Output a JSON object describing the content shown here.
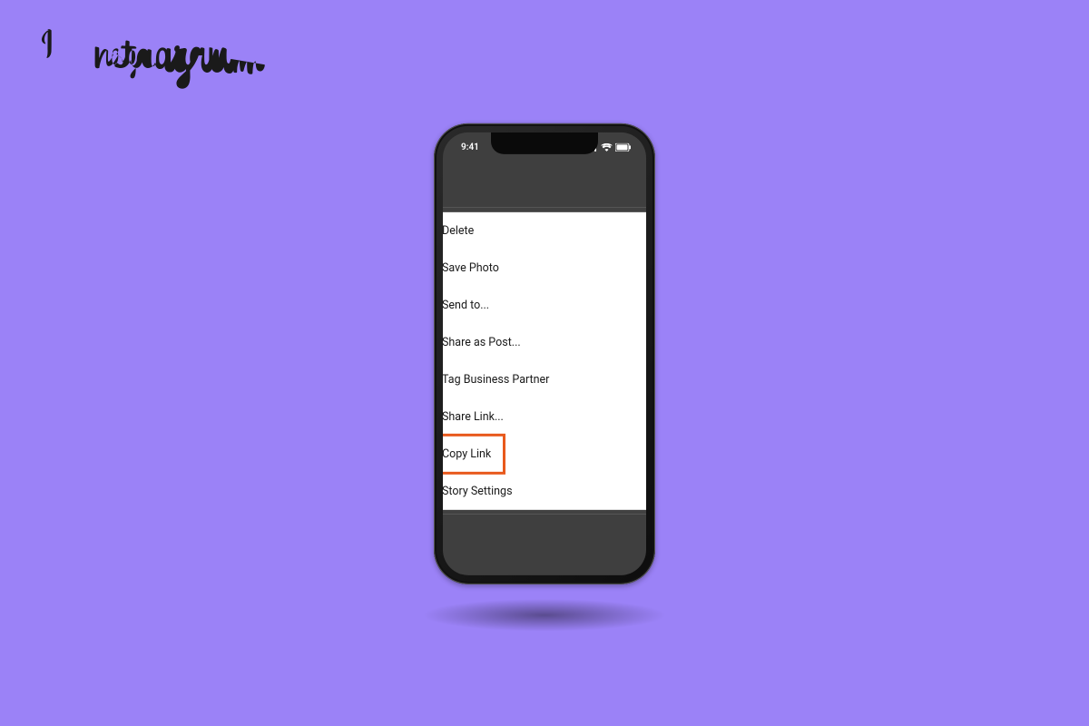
{
  "brand": "Instagram",
  "status": {
    "time": "9:41"
  },
  "menu": {
    "items": [
      {
        "label": "Delete",
        "highlighted": false
      },
      {
        "label": "Save Photo",
        "highlighted": false
      },
      {
        "label": "Send to...",
        "highlighted": false
      },
      {
        "label": "Share as Post...",
        "highlighted": false
      },
      {
        "label": "Tag Business Partner",
        "highlighted": false
      },
      {
        "label": "Share Link...",
        "highlighted": false
      },
      {
        "label": "Copy Link",
        "highlighted": true
      },
      {
        "label": "Story Settings",
        "highlighted": false
      }
    ]
  }
}
